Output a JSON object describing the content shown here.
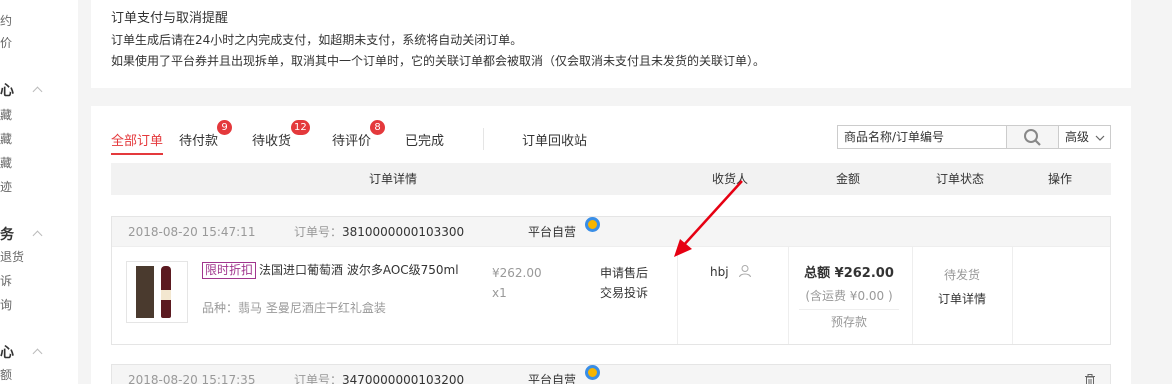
{
  "sidebar": {
    "items": [
      {
        "label": "约",
        "type": "item"
      },
      {
        "label": "价",
        "type": "item"
      },
      {
        "label": "心",
        "type": "head"
      },
      {
        "label": "藏",
        "type": "item"
      },
      {
        "label": "藏",
        "type": "item"
      },
      {
        "label": "藏",
        "type": "item"
      },
      {
        "label": "迹",
        "type": "item"
      },
      {
        "label": "务",
        "type": "head"
      },
      {
        "label": "退货",
        "type": "item"
      },
      {
        "label": "诉",
        "type": "item"
      },
      {
        "label": "询",
        "type": "item"
      },
      {
        "label": "心",
        "type": "head"
      },
      {
        "label": "额",
        "type": "item"
      }
    ]
  },
  "notice": {
    "title": "订单支付与取消提醒",
    "line1": "订单生成后请在24小时之内完成支付，如超期未支付，系统将自动关闭订单。",
    "line2": "如果使用了平台券并且出现拆单，取消其中一个订单时，它的关联订单都会被取消（仅会取消未支付且未发货的关联订单）。"
  },
  "tabs": [
    {
      "label": "全部订单",
      "badge": ""
    },
    {
      "label": "待付款",
      "badge": "9"
    },
    {
      "label": "待收货",
      "badge": "12"
    },
    {
      "label": "待评价",
      "badge": "8"
    },
    {
      "label": "已完成",
      "badge": ""
    },
    {
      "label": "订单回收站",
      "badge": ""
    }
  ],
  "search": {
    "value": "商品名称/订单编号",
    "advanced_label": "高级"
  },
  "table_headers": [
    "订单详情",
    "收货人",
    "金额",
    "订单状态",
    "操作"
  ],
  "orders": [
    {
      "time": "2018-08-20 15:47:11",
      "number_label": "订单号：",
      "number": "3810000000103300",
      "shop": "平台自营",
      "promo_tag": "限时折扣",
      "product_name": "法国进口葡萄酒 波尔多AOC级750ml",
      "variant": "品种：翡马 圣曼尼酒庄干红礼盒装",
      "unit_price": "¥262.00",
      "quantity": "x1",
      "after_sale": "申请售后",
      "complaint": "交易投诉",
      "receiver": "hbj",
      "total_label": "总额",
      "total": "¥262.00",
      "shipping": "(含运费 ¥0.00 )",
      "pay_type": "预存款",
      "status": "待发货",
      "detail_link": "订单详情"
    },
    {
      "time": "2018-08-20 15:17:35",
      "number_label": "订单号：",
      "number": "3470000000103200",
      "shop": "平台自营"
    }
  ],
  "colors": {
    "accent": "#e4393c",
    "promo": "#a0358d",
    "arrow": "#e60012"
  }
}
